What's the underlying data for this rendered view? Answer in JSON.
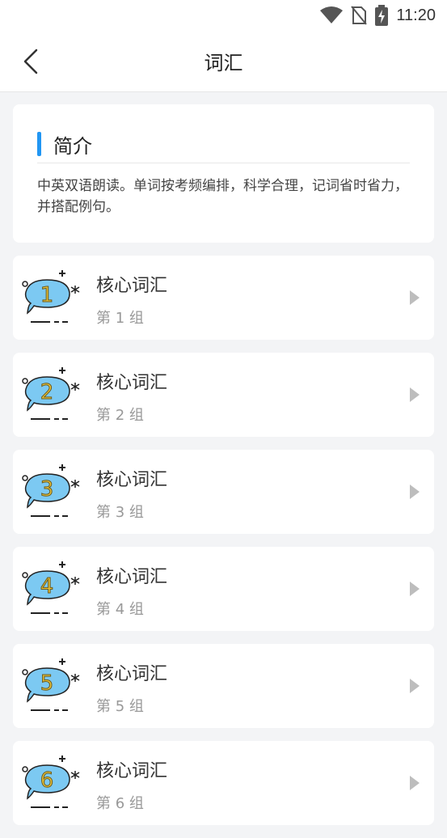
{
  "status_bar": {
    "time": "11:20",
    "icons": [
      "wifi-icon",
      "no-sim-icon",
      "battery-charging-icon"
    ]
  },
  "header": {
    "title": "词汇",
    "back_icon": "chevron-left-icon"
  },
  "intro": {
    "title": "简介",
    "text": "中英双语朗读。单词按考频编排，科学合理，记词省时省力，并搭配例句。"
  },
  "items": [
    {
      "title": "核心词汇",
      "subtitle": "第 1 组",
      "badge": "1"
    },
    {
      "title": "核心词汇",
      "subtitle": "第 2 组",
      "badge": "2"
    },
    {
      "title": "核心词汇",
      "subtitle": "第 3 组",
      "badge": "3"
    },
    {
      "title": "核心词汇",
      "subtitle": "第 4 组",
      "badge": "4"
    },
    {
      "title": "核心词汇",
      "subtitle": "第 5 组",
      "badge": "5"
    },
    {
      "title": "核心词汇",
      "subtitle": "第 6 组",
      "badge": "6"
    }
  ],
  "colors": {
    "accent": "#2196f3",
    "bubble_fill": "#7cc9f2",
    "badge_number": "#e8c23a",
    "arrow": "#bdbdbd"
  }
}
